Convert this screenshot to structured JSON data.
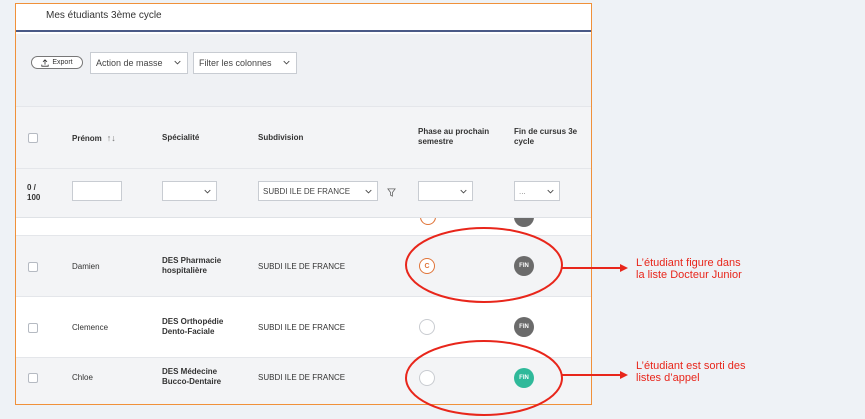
{
  "tab": {
    "title": "Mes étudiants 3ème cycle"
  },
  "toolbar": {
    "export_label": "Export",
    "mass_action_label": "Action de masse",
    "columns_filter_label": "Filter les colonnes"
  },
  "table": {
    "headers": {
      "prenom": "Prénom",
      "specialite": "Spécialité",
      "subdivision": "Subdivision",
      "phase_line1": "Phase au prochain",
      "phase_line2": "semestre",
      "fin_line1": "Fin de cursus 3e",
      "fin_line2": "cycle"
    },
    "filters": {
      "count_line1": "0 /",
      "count_line2": "100",
      "prenom_value": "",
      "subdivision_value": "SUBDI ILE DE FRANCE",
      "fin_value": "..."
    },
    "rows": [
      {
        "prenom": "Damien",
        "specialite_line1": "DES Pharmacie",
        "specialite_line2": "hospitalière",
        "subdivision": "SUBDI ILE DE FRANCE",
        "phase": "C",
        "fin": "FIN"
      },
      {
        "prenom": "Clemence",
        "specialite_line1": "DES Orthopédie",
        "specialite_line2": "Dento-Faciale",
        "subdivision": "SUBDI ILE DE FRANCE",
        "phase": "",
        "fin": "FIN"
      },
      {
        "prenom": "Chloe",
        "specialite_line1": "DES Médecine",
        "specialite_line2": "Bucco-Dentaire",
        "subdivision": "SUBDI ILE DE FRANCE",
        "phase": "",
        "fin": "FIN"
      }
    ]
  },
  "annotations": {
    "note1_line1": "L’étudiant figure dans",
    "note1_line2": "la liste Docteur Junior",
    "note2_line1": "L’étudiant est sorti des",
    "note2_line2": "listes d’appel"
  },
  "colors": {
    "frame_border": "#f0913a",
    "annotation_red": "#e8261b",
    "badge_grey": "#6b6b6b",
    "badge_teal": "#2fb99a",
    "phase_orange": "#e0753a"
  },
  "icons": [
    "upload-icon",
    "chevron-down-icon",
    "sort-icon",
    "funnel-icon"
  ]
}
